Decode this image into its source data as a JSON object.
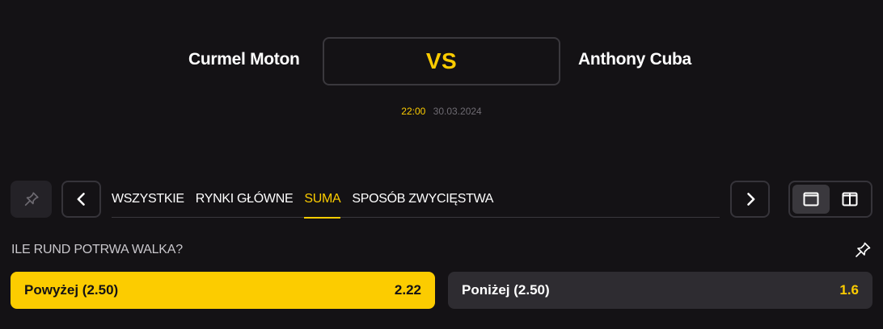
{
  "match": {
    "home_team": "Curmel Moton",
    "away_team": "Anthony Cuba",
    "vs_label": "VS",
    "time": "22:00",
    "date": "30.03.2024"
  },
  "toolbar": {
    "pin_icon": "pin-icon",
    "prev_icon": "chevron-left-icon",
    "next_icon": "chevron-right-icon",
    "tabs": [
      {
        "label": "WSZYSTKIE",
        "active": false
      },
      {
        "label": "RYNKI GŁÓWNE",
        "active": false
      },
      {
        "label": "SUMA",
        "active": true
      },
      {
        "label": "SPOSÓB ZWYCIĘSTWA",
        "active": false
      }
    ],
    "view_modes": [
      {
        "icon": "single-column-icon",
        "active": true
      },
      {
        "icon": "two-column-icon",
        "active": false
      }
    ]
  },
  "market": {
    "title": "ILE RUND POTRWA WALKA?",
    "pin_icon": "pin-icon",
    "outcomes": [
      {
        "label": "Powyżej (2.50)",
        "odds": "2.22",
        "selected": true
      },
      {
        "label": "Poniżej (2.50)",
        "odds": "1.6",
        "selected": false
      }
    ]
  },
  "colors": {
    "background": "#141215",
    "accent": "#fccc00",
    "panel": "#2e2c31",
    "border": "#36343a"
  }
}
